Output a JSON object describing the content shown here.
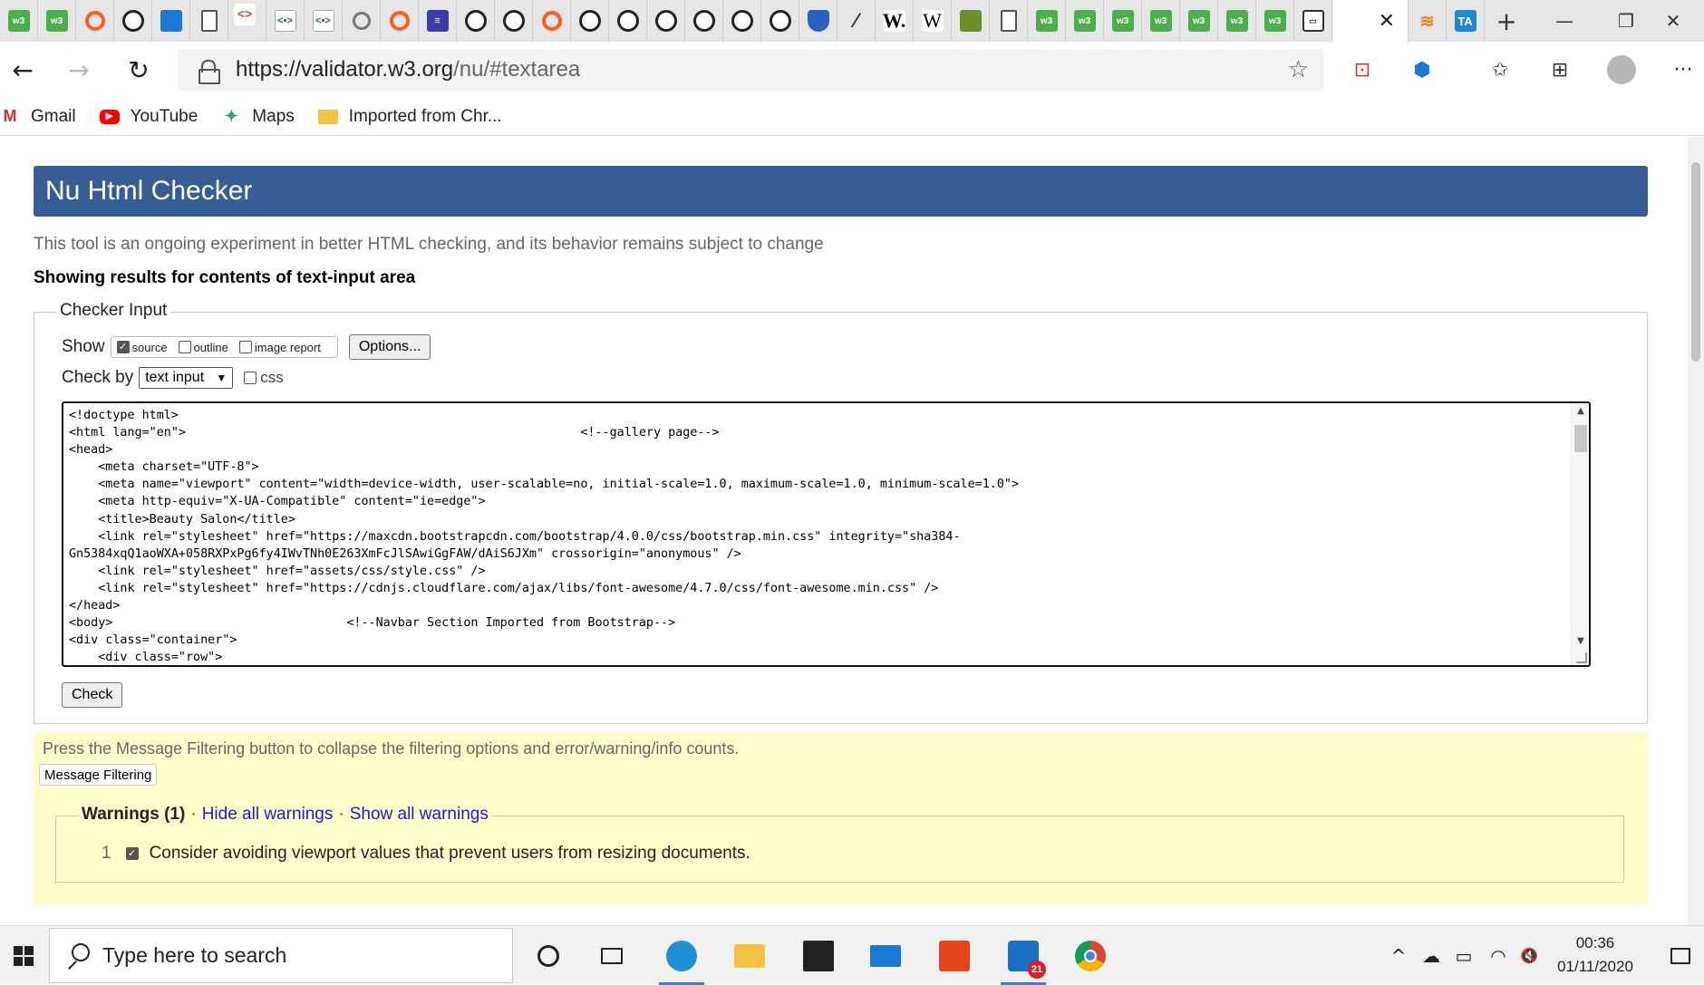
{
  "browser": {
    "tabs": [
      {
        "icon": "w3-icon",
        "glyph": "w3"
      },
      {
        "icon": "w3-icon",
        "glyph": "w3"
      },
      {
        "icon": "orange-circle-icon",
        "glyph": ""
      },
      {
        "icon": "github-icon",
        "glyph": ""
      },
      {
        "icon": "blue-cube-icon",
        "glyph": ""
      },
      {
        "icon": "document-icon",
        "glyph": ""
      },
      {
        "icon": "code-brackets-icon",
        "glyph": "<>"
      },
      {
        "icon": "code-eye-icon",
        "glyph": "<•>"
      },
      {
        "icon": "code-eye-icon",
        "glyph": "<•>"
      },
      {
        "icon": "gear-icon",
        "glyph": ""
      },
      {
        "icon": "orange-circle-icon",
        "glyph": ""
      },
      {
        "icon": "purple-list-icon",
        "glyph": "≡"
      },
      {
        "icon": "github-icon",
        "glyph": ""
      },
      {
        "icon": "github-icon",
        "glyph": ""
      },
      {
        "icon": "orange-circle-icon",
        "glyph": ""
      },
      {
        "icon": "github-icon",
        "glyph": ""
      },
      {
        "icon": "github-icon",
        "glyph": ""
      },
      {
        "icon": "github-icon",
        "glyph": ""
      },
      {
        "icon": "github-icon",
        "glyph": ""
      },
      {
        "icon": "github-icon",
        "glyph": ""
      },
      {
        "icon": "github-icon",
        "glyph": ""
      },
      {
        "icon": "shield-icon",
        "glyph": ""
      },
      {
        "icon": "pen-icon",
        "glyph": "⁄"
      },
      {
        "icon": "w-bold-icon",
        "glyph": "W."
      },
      {
        "icon": "wikipedia-icon",
        "glyph": "W"
      },
      {
        "icon": "book-icon",
        "glyph": ""
      },
      {
        "icon": "document-icon",
        "glyph": ""
      },
      {
        "icon": "w3-icon",
        "glyph": "w3"
      },
      {
        "icon": "w3-icon",
        "glyph": "w3"
      },
      {
        "icon": "w3-icon",
        "glyph": "w3"
      },
      {
        "icon": "w3-icon",
        "glyph": "w3"
      },
      {
        "icon": "w3-icon",
        "glyph": "w3"
      },
      {
        "icon": "w3-icon",
        "glyph": "w3"
      },
      {
        "icon": "w3-icon",
        "glyph": "w3"
      },
      {
        "icon": "grid-window-icon",
        "glyph": "▭"
      }
    ],
    "active_tab_close": "✕",
    "after_tabs": [
      {
        "icon": "stackoverflow-icon",
        "glyph": "≋"
      },
      {
        "icon": "ta-icon",
        "glyph": "TA"
      }
    ],
    "new_tab": "+",
    "window": {
      "minimize": "—",
      "restore": "❐",
      "close": "✕"
    },
    "nav": {
      "back": "←",
      "forward": "→",
      "reload": "↻"
    },
    "url_host": "https://validator.w3.org",
    "url_path": "/nu/#textarea",
    "favorite_star": "☆",
    "toolbar_icons": {
      "ext1": "⊡",
      "ext2": "⬢",
      "favorites": "✩",
      "collections": "⊞",
      "menu": "···"
    },
    "bookmarks": [
      {
        "icon": "gmail-icon",
        "glyph": "M",
        "label": "Gmail"
      },
      {
        "icon": "youtube-icon",
        "glyph": "▶",
        "label": "YouTube"
      },
      {
        "icon": "maps-icon",
        "glyph": "✦",
        "label": "Maps"
      },
      {
        "icon": "folder-icon",
        "glyph": "",
        "label": "Imported from Chr..."
      }
    ]
  },
  "page": {
    "title": "Nu Html Checker",
    "intro": "This tool is an ongoing experiment in better HTML checking, and its behavior remains subject to change",
    "showing": "Showing results for contents of text-input area",
    "checker_legend": "Checker Input",
    "show_label": "Show",
    "show_options": [
      {
        "label": "source",
        "checked": true
      },
      {
        "label": "outline",
        "checked": false
      },
      {
        "label": "image report",
        "checked": false
      }
    ],
    "options_button": "Options...",
    "check_by_label": "Check by",
    "check_by_value": "text input",
    "css_label": "css",
    "css_checked": false,
    "code_lines": [
      "<!doctype html>",
      "<html lang=\"en\">                                                      <!--gallery page-->",
      "<head>",
      "    <meta charset=\"UTF-8\">",
      "    <meta name=\"viewport\" content=\"width=device-width, user-scalable=no, initial-scale=1.0, maximum-scale=1.0, minimum-scale=1.0\">",
      "    <meta http-equiv=\"X-UA-Compatible\" content=\"ie=edge\">",
      "    <title>Beauty Salon</title>",
      "    <link rel=\"stylesheet\" href=\"https://maxcdn.bootstrapcdn.com/bootstrap/4.0.0/css/bootstrap.min.css\" integrity=\"sha384-",
      "Gn5384xqQ1aoWXA+058RXPxPg6fy4IWvTNh0E263XmFcJlSAwiGgFAW/dAiS6JXm\" crossorigin=\"anonymous\" />",
      "    <link rel=\"stylesheet\" href=\"assets/css/style.css\" />",
      "    <link rel=\"stylesheet\" href=\"https://cdnjs.cloudflare.com/ajax/libs/font-awesome/4.7.0/css/font-awesome.min.css\" />",
      "</head>",
      "<body>                                <!--Navbar Section Imported from Bootstrap-->",
      "<div class=\"container\">",
      "    <div class=\"row\">"
    ],
    "check_button": "Check",
    "filter_hint": "Press the Message Filtering button to collapse the filtering options and error/warning/info counts.",
    "filter_button": "Message Filtering",
    "warnings_title": "Warnings (1)",
    "separator": "·",
    "hide_warnings": "Hide all warnings",
    "show_warnings": "Show all warnings",
    "messages": [
      {
        "num": "1",
        "checked": true,
        "text": "Consider avoiding viewport values that prevent users from resizing documents."
      }
    ]
  },
  "taskbar": {
    "search_placeholder": "Type here to search",
    "apps": [
      {
        "icon": "cortana-icon"
      },
      {
        "icon": "task-view-icon"
      },
      {
        "icon": "edge-icon",
        "open": true
      },
      {
        "icon": "file-explorer-icon"
      },
      {
        "icon": "store-icon"
      },
      {
        "icon": "mail-icon"
      },
      {
        "icon": "office-icon"
      },
      {
        "icon": "calendar-app-icon",
        "badge": "21",
        "open": true
      },
      {
        "icon": "chrome-icon"
      }
    ],
    "tray": {
      "chevron": "^",
      "cloud": "☁",
      "battery": "▭",
      "wifi": "◠",
      "volume": "🔇"
    },
    "time": "00:36",
    "date": "01/11/2020"
  }
}
